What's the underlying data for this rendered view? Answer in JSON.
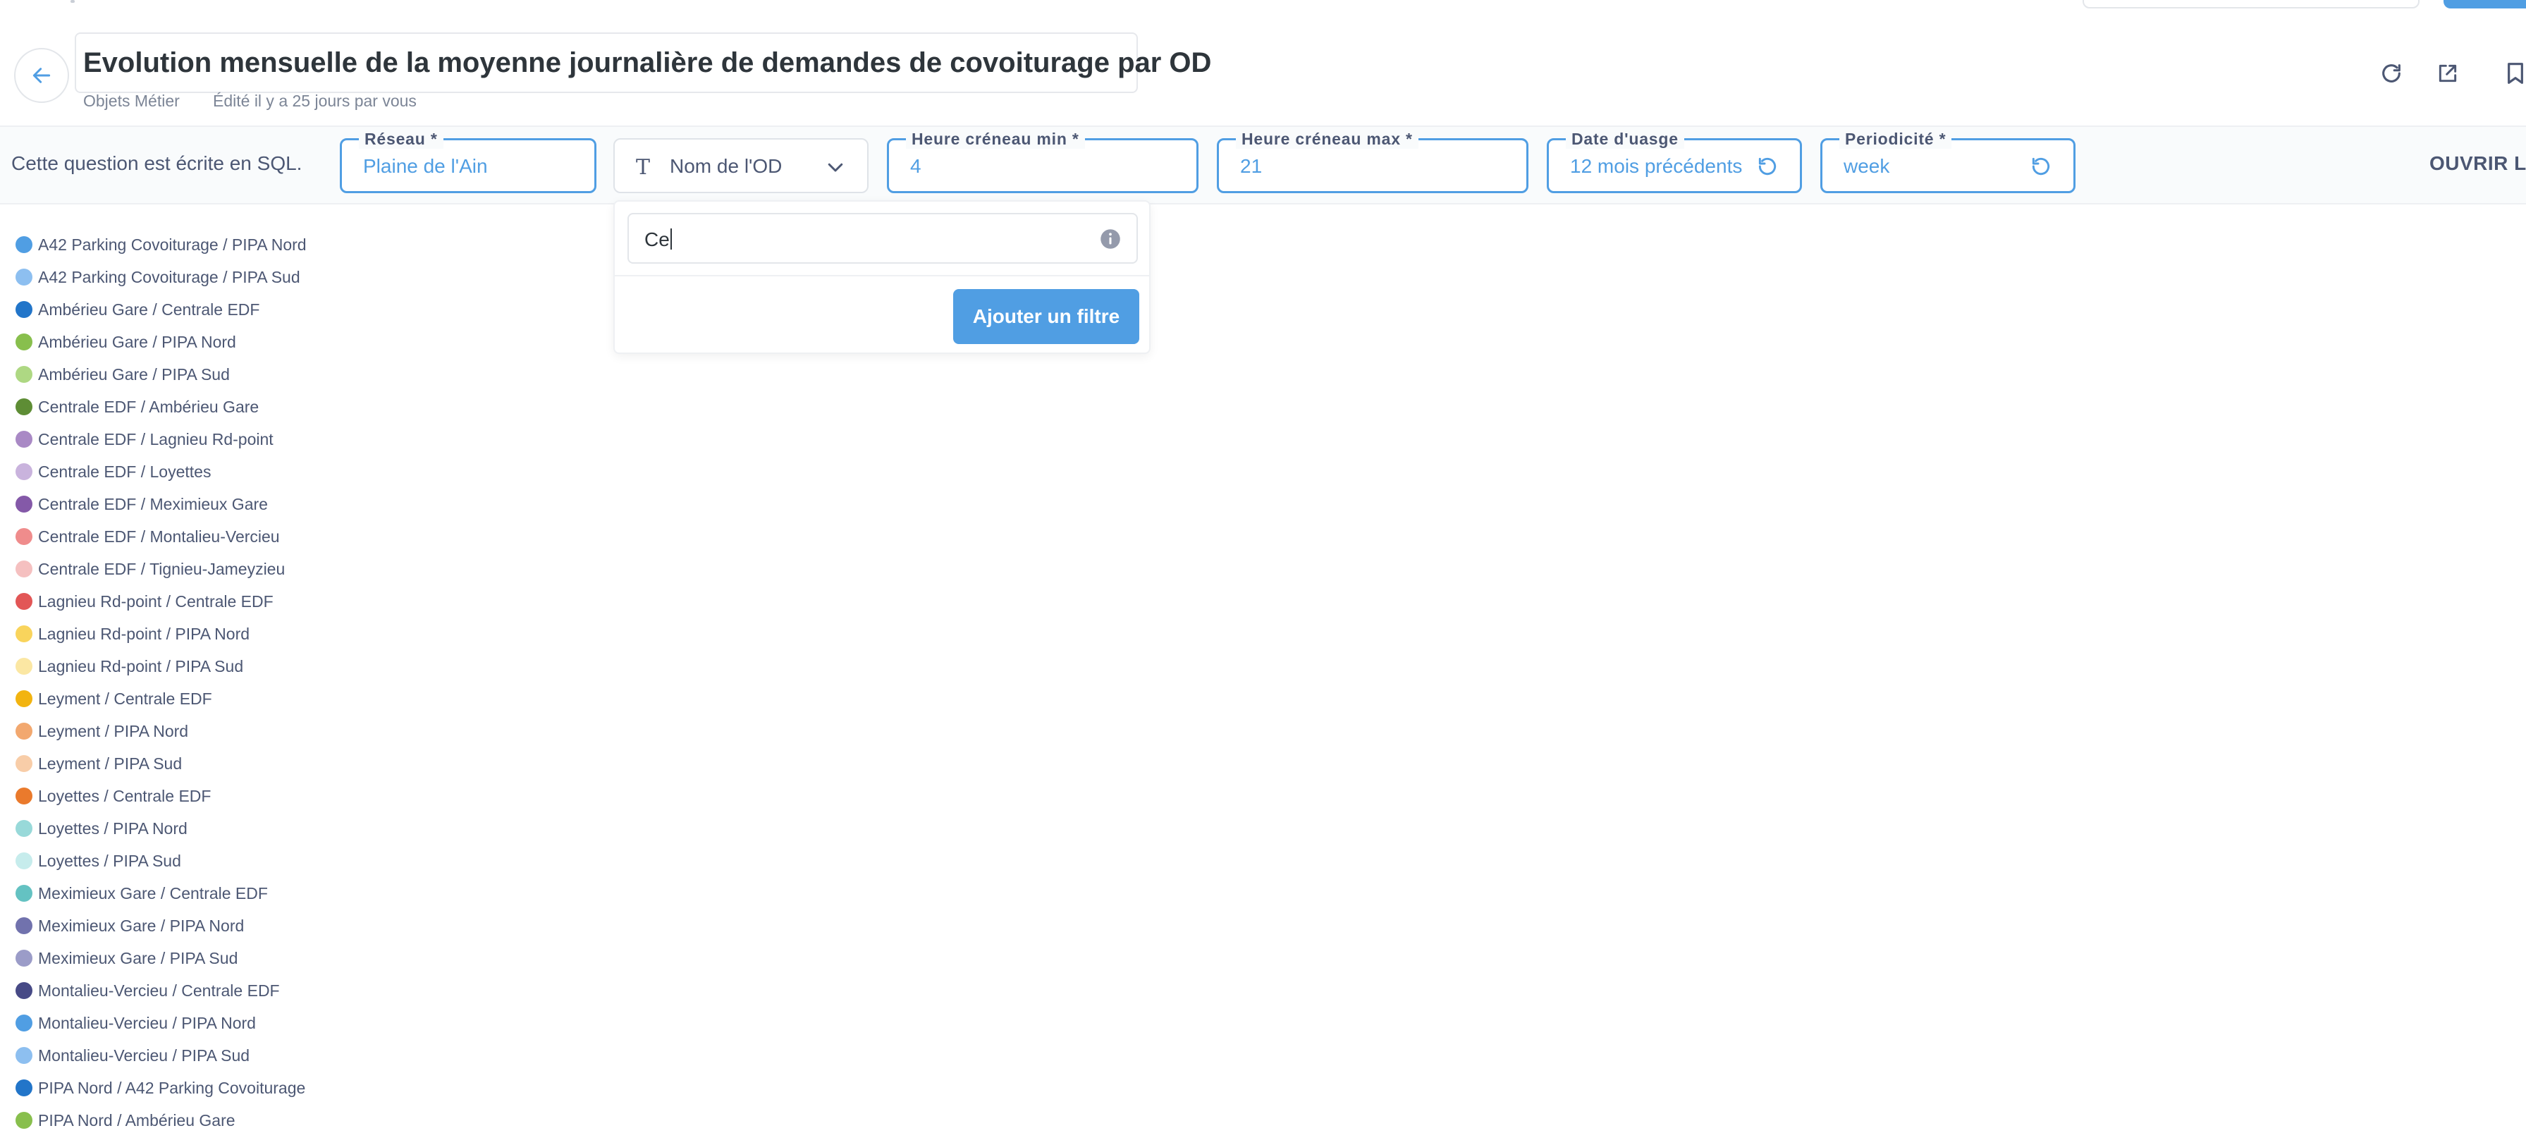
{
  "header": {
    "title": "Evolution mensuelle de la moyenne journalière de demandes de covoiturage par OD",
    "collection": "Objets Métier",
    "edited": "Édité il y a 25 jours par vous"
  },
  "params": {
    "sql_note": "Cette question est écrite en SQL.",
    "open_editor": "OUVRIR L'É",
    "reseau": {
      "label": "Réseau *",
      "value": "Plaine de l'Ain"
    },
    "od_filter": {
      "label": "Nom de l'OD"
    },
    "heure_min": {
      "label": "Heure créneau min *",
      "value": "4"
    },
    "heure_max": {
      "label": "Heure créneau max *",
      "value": "21"
    },
    "date_usage": {
      "label": "Date d'uasge",
      "value": "12 mois précédents"
    },
    "periodicite": {
      "label": "Periodicité *",
      "value": "week"
    }
  },
  "popover": {
    "input_value": "Ce",
    "button_label": "Ajouter un filtre"
  },
  "colors": {
    "accent": "#509ee3",
    "text": "#4c5773"
  },
  "legend": [
    {
      "label": "A42 Parking Covoiturage / PIPA Nord",
      "color": "#509ee3"
    },
    {
      "label": "A42 Parking Covoiturage / PIPA Sud",
      "color": "#8dbff0"
    },
    {
      "label": "Ambérieu Gare / Centrale EDF",
      "color": "#2275c9"
    },
    {
      "label": "Ambérieu Gare / PIPA Nord",
      "color": "#88bf4d"
    },
    {
      "label": "Ambérieu Gare / PIPA Sud",
      "color": "#aed883"
    },
    {
      "label": "Centrale EDF / Ambérieu Gare",
      "color": "#5e8d35"
    },
    {
      "label": "Centrale EDF / Lagnieu Rd-point",
      "color": "#a989c5"
    },
    {
      "label": "Centrale EDF / Loyettes",
      "color": "#c9b3dd"
    },
    {
      "label": "Centrale EDF / Meximieux Gare",
      "color": "#8459a8"
    },
    {
      "label": "Centrale EDF / Montalieu-Vercieu",
      "color": "#ef8c8c"
    },
    {
      "label": "Centrale EDF / Tignieu-Jameyzieu",
      "color": "#f5c0c0"
    },
    {
      "label": "Lagnieu Rd-point / Centrale EDF",
      "color": "#e25656"
    },
    {
      "label": "Lagnieu Rd-point / PIPA Nord",
      "color": "#f9d45c"
    },
    {
      "label": "Lagnieu Rd-point / PIPA Sud",
      "color": "#fbe7a3"
    },
    {
      "label": "Leyment / Centrale EDF",
      "color": "#f2b410"
    },
    {
      "label": "Leyment / PIPA Nord",
      "color": "#f2a86f"
    },
    {
      "label": "Leyment / PIPA Sud",
      "color": "#f8cda8"
    },
    {
      "label": "Loyettes / Centrale EDF",
      "color": "#ea7a2c"
    },
    {
      "label": "Loyettes / PIPA Nord",
      "color": "#98d9d9"
    },
    {
      "label": "Loyettes / PIPA Sud",
      "color": "#c6ecec"
    },
    {
      "label": "Meximieux Gare / Centrale EDF",
      "color": "#64c2c2"
    },
    {
      "label": "Meximieux Gare / PIPA Nord",
      "color": "#7172ad"
    },
    {
      "label": "Meximieux Gare / PIPA Sud",
      "color": "#9b9cc8"
    },
    {
      "label": "Montalieu-Vercieu / Centrale EDF",
      "color": "#474a86"
    },
    {
      "label": "Montalieu-Vercieu / PIPA Nord",
      "color": "#509ee3"
    },
    {
      "label": "Montalieu-Vercieu / PIPA Sud",
      "color": "#8dbff0"
    },
    {
      "label": "PIPA Nord / A42 Parking Covoiturage",
      "color": "#2275c9"
    },
    {
      "label": "PIPA Nord / Ambérieu Gare",
      "color": "#88bf4d"
    }
  ]
}
